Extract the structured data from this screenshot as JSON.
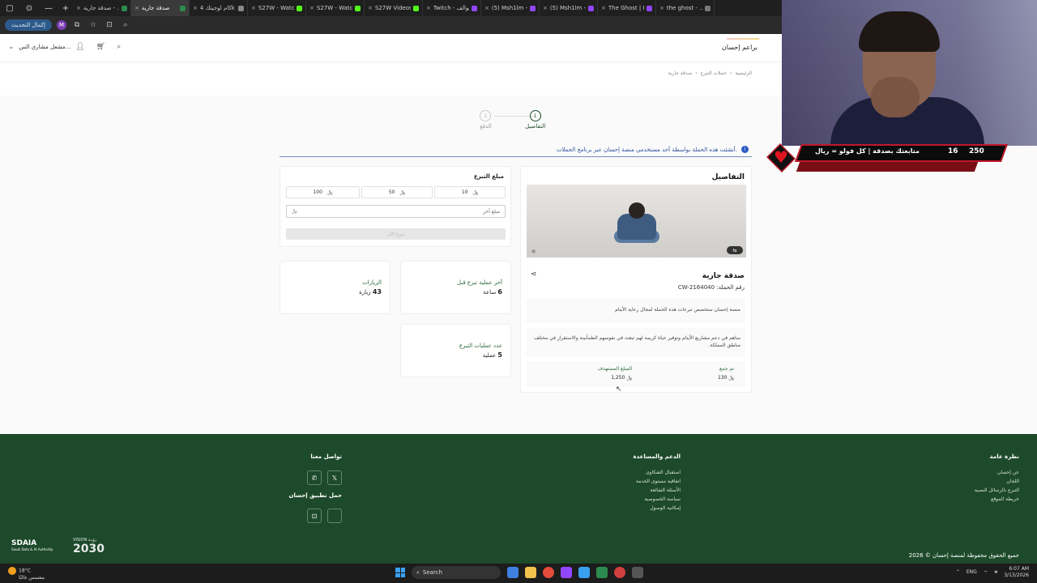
{
  "browser": {
    "tabs": [
      {
        "label": "صدقة جارية - ...",
        "color": "#2d8a4e",
        "active": false
      },
      {
        "label": "صدقة جارية",
        "color": "#2d8a4e",
        "active": true
      },
      {
        "label": "كام لوجيتك 4k",
        "color": "#888888",
        "active": false
      },
      {
        "label": "S27W - Watch",
        "color": "#53fc18",
        "active": false
      },
      {
        "label": "S27W - Watch",
        "color": "#53fc18",
        "active": false
      },
      {
        "label": "S27W Videos",
        "color": "#53fc18",
        "active": false
      },
      {
        "label": "Twitch - سوالف",
        "color": "#9146ff",
        "active": false
      },
      {
        "label": "(5) Msh1lm - T",
        "color": "#9146ff",
        "active": false
      },
      {
        "label": "(5) Msh1lm - T",
        "color": "#9146ff",
        "active": false
      },
      {
        "label": "The Ghost | M",
        "color": "#9146ff",
        "active": false
      },
      {
        "label": "the ghost - ...",
        "color": "#777777",
        "active": false
      }
    ],
    "update_label": "إكمال التحديث",
    "profile_letter": "M"
  },
  "header": {
    "brand": "براعم إحسان",
    "user_name": "مشعل مشاري الس..."
  },
  "breadcrumb": [
    "الرئيسية",
    "حملات التبرع",
    "صدقة جارية"
  ],
  "stepper": {
    "step1": {
      "num": "1",
      "label": "التفاصيل"
    },
    "step2": {
      "num": "2",
      "label": "الدفع"
    }
  },
  "notice": "أنشئت هذه الحملة بواسطة أحد مستخدمي منصة إحسان عبر برنامج الحملات.",
  "details": {
    "heading": "التفاصيل",
    "title": "صدقة جارية",
    "campaign_id": "رقم الحملة:  CW-2164040",
    "desc1": "منصة إحسان ستخصص تبرعات هذه الحملة لمجال رعاية الأيتام",
    "desc2": "ساهم في دعم مشاريع الأيتام وتوفير حياة كريمة لهم تبعث في نفوسهم الطمأنينة والاستقرار في مختلف مناطق المملكة.",
    "collected_label": "تم جمع",
    "collected_value": "130",
    "target_label": "المبلغ المستهدف",
    "target_value": "1,250"
  },
  "donation": {
    "heading": "مبلغ التبرع",
    "amounts": [
      "10",
      "50",
      "100"
    ],
    "currency": "﷼",
    "other_placeholder": "مبلغ آخر",
    "donate_label": "تبرع الآن"
  },
  "stats": {
    "last_donation_label": "آخر عملية تبرع قبل",
    "last_donation_value": "6",
    "last_donation_unit": "ساعة",
    "visits_label": "الزيارات",
    "visits_value": "43",
    "visits_unit": "زيارة",
    "ops_label": "عدد عمليات التبرع",
    "ops_value": "5",
    "ops_unit": "عملية"
  },
  "footer": {
    "col_overview": {
      "heading": "نظرة عامة",
      "items": [
        "عن إحسان",
        "اللجان",
        "التبرع بالرسائل النصية",
        "خريطة الموقع"
      ]
    },
    "col_support": {
      "heading": "الدعم والمساعدة",
      "items": [
        "استقبال الشكاوى",
        "اتفاقية مستوى الخدمة",
        "الأسئلة الشائعة",
        "سياسة الخصوصية",
        "إمكانية الوصول"
      ]
    },
    "contact_heading": "تواصل معنا",
    "app_heading": "حمل تطبيق إحسان",
    "copyright": "جميع الحقوق محفوظة لمنصة إحسان © 2026",
    "sdaia": "SDAIA",
    "sdaia_sub": "Saudi Data & AI Authority",
    "vision": "2030",
    "vision_sub": "VISION رؤيـة"
  },
  "taskbar": {
    "temp": "18°C",
    "weather": "مشمس غالبًا",
    "search": "Search",
    "lang": "ENG",
    "time": "6:07 AM",
    "date": "3/13/2026"
  },
  "overlay": {
    "message": "متابعتك بصدقة | كل فولو = ريال",
    "count_a": "16",
    "count_b": "250"
  }
}
